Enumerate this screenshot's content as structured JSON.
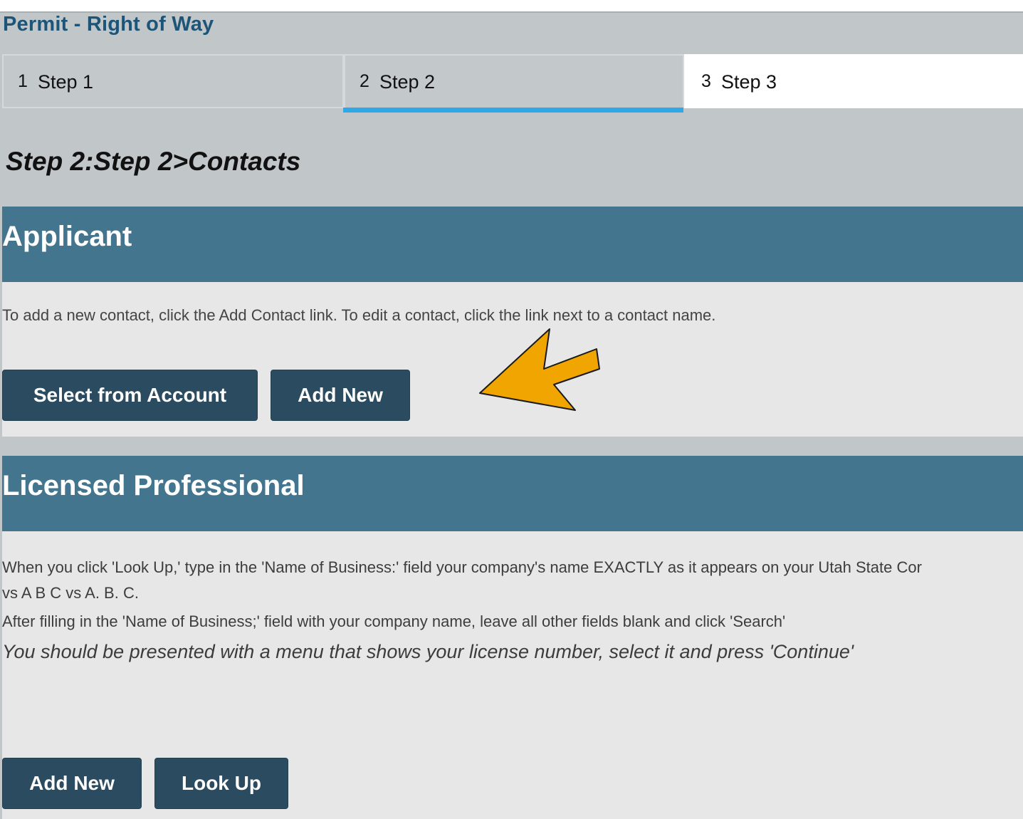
{
  "page_title": "Permit - Right of Way",
  "steps": [
    {
      "num": "1",
      "label": "Step 1"
    },
    {
      "num": "2",
      "label": "Step 2"
    },
    {
      "num": "3",
      "label": "Step 3"
    }
  ],
  "heading": "Step 2:Step 2>Contacts",
  "applicant": {
    "title": "Applicant",
    "instruction": "To add a new contact, click the Add Contact link. To edit a contact, click the link next to a contact name.",
    "select_button": "Select from Account",
    "add_new_button": "Add New"
  },
  "licensed_professional": {
    "title": "Licensed Professional",
    "line1": "When you click 'Look Up,' type in the 'Name of Business:' field your company's name EXACTLY as it appears on your Utah State Cor",
    "line2": "vs A B C vs A. B. C.",
    "line3": "After filling in the 'Name of Business;' field with your company name, leave all other fields blank and click 'Search'",
    "line4": "You should be presented with a menu that shows your license number, select it and press 'Continue'",
    "add_new_button": "Add New",
    "look_up_button": "Look Up"
  },
  "colors": {
    "accent_arrow": "#f0a500",
    "section_header": "#44758e",
    "button": "#2b4c60",
    "active_step_underline": "#30a8e8"
  }
}
